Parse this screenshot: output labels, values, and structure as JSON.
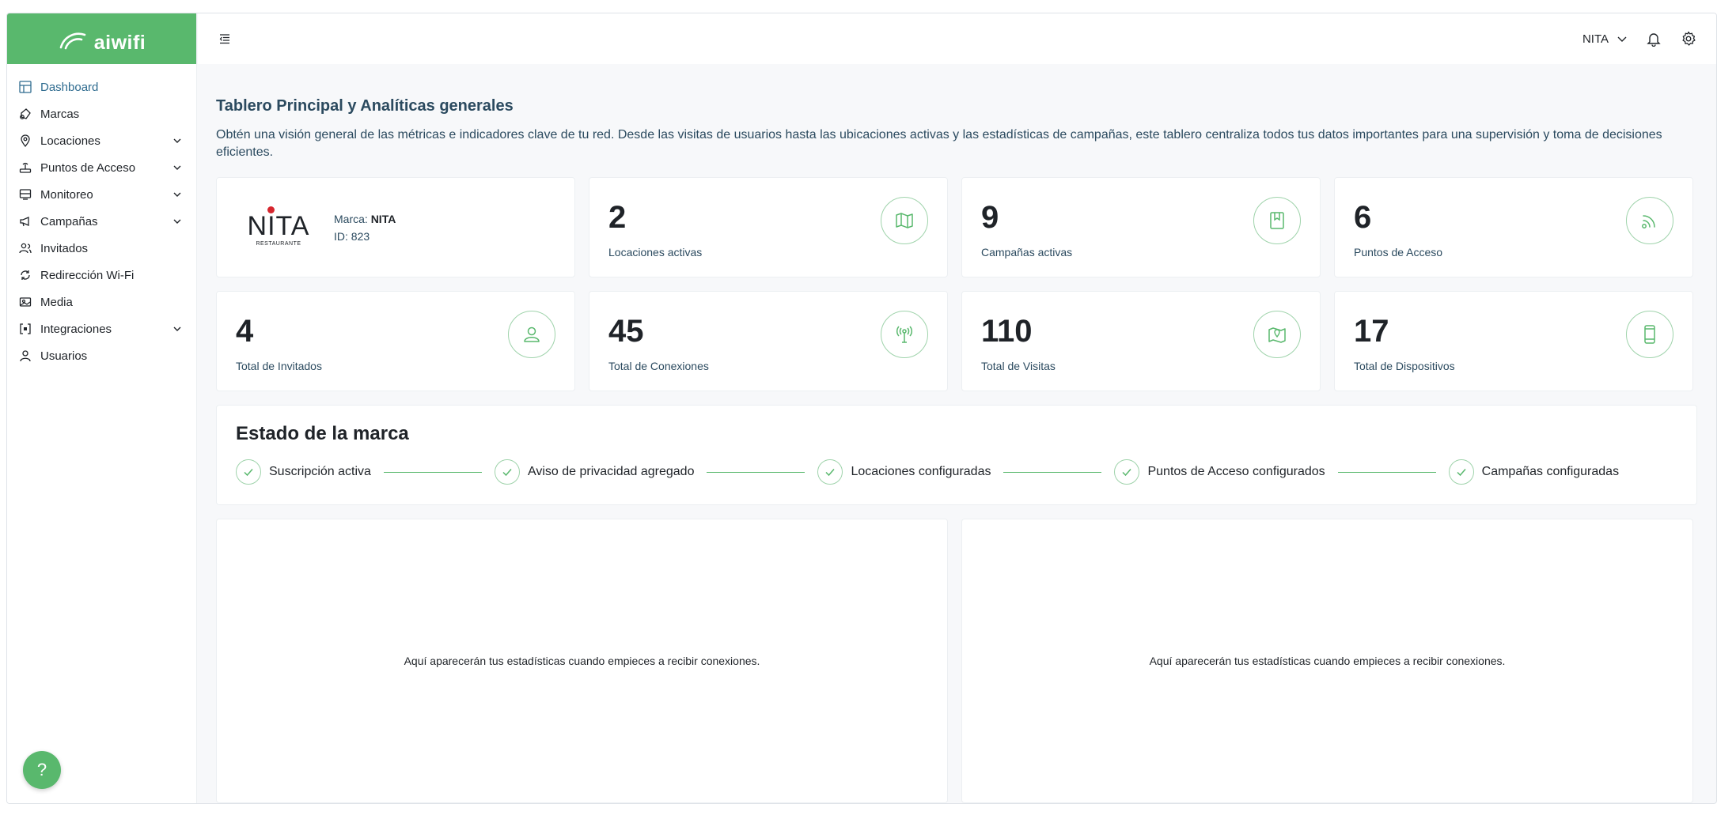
{
  "brand": {
    "logo_text": "aiwifi",
    "accent_color": "#59b86d"
  },
  "sidebar": {
    "items": [
      {
        "label": "Dashboard",
        "icon": "dashboard-icon",
        "active": true,
        "expandable": false
      },
      {
        "label": "Marcas",
        "icon": "brands-icon",
        "active": false,
        "expandable": false
      },
      {
        "label": "Locaciones",
        "icon": "location-pin-icon",
        "active": false,
        "expandable": true
      },
      {
        "label": "Puntos de Acceso",
        "icon": "router-icon",
        "active": false,
        "expandable": true
      },
      {
        "label": "Monitoreo",
        "icon": "monitor-icon",
        "active": false,
        "expandable": true
      },
      {
        "label": "Campañas",
        "icon": "megaphone-icon",
        "active": false,
        "expandable": true
      },
      {
        "label": "Invitados",
        "icon": "users-icon",
        "active": false,
        "expandable": false
      },
      {
        "label": "Redirección Wi-Fi",
        "icon": "redirect-icon",
        "active": false,
        "expandable": false
      },
      {
        "label": "Media",
        "icon": "media-icon",
        "active": false,
        "expandable": false
      },
      {
        "label": "Integraciones",
        "icon": "integrations-icon",
        "active": false,
        "expandable": true
      },
      {
        "label": "Usuarios",
        "icon": "user-icon",
        "active": false,
        "expandable": false
      }
    ],
    "help_label": "?"
  },
  "topbar": {
    "brand_selector": "NITA"
  },
  "main": {
    "title": "Tablero Principal y Analíticas generales",
    "description": "Obtén una visión general de las métricas e indicadores clave de tu red. Desde las visitas de usuarios hasta las ubicaciones activas y las estadísticas de campañas, este tablero centraliza todos tus datos importantes para una supervisión y toma de decisiones eficientes.",
    "brand_card": {
      "logo_name": "NITA",
      "logo_sub": "RESTAURANTE",
      "brand_label": "Marca:",
      "brand_value": "NITA",
      "id_label": "ID:",
      "id_value": "823"
    },
    "stats": [
      {
        "value": "2",
        "label": "Locaciones activas",
        "icon": "map-icon"
      },
      {
        "value": "9",
        "label": "Campañas activas",
        "icon": "bookmark-book-icon"
      },
      {
        "value": "6",
        "label": "Puntos de Acceso",
        "icon": "wifi-signal-icon"
      },
      {
        "value": "4",
        "label": "Total de Invitados",
        "icon": "user-icon"
      },
      {
        "value": "45",
        "label": "Total de Conexiones",
        "icon": "antenna-icon"
      },
      {
        "value": "110",
        "label": "Total de Visitas",
        "icon": "map-pin-icon"
      },
      {
        "value": "17",
        "label": "Total de Dispositivos",
        "icon": "phone-icon"
      }
    ],
    "status": {
      "title": "Estado de la marca",
      "steps": [
        "Suscripción activa",
        "Aviso de privacidad agregado",
        "Locaciones configuradas",
        "Puntos de Acceso configurados",
        "Campañas configuradas"
      ]
    },
    "charts": [
      {
        "empty_message": "Aquí aparecerán tus estadísticas cuando empieces a recibir conexiones."
      },
      {
        "empty_message": "Aquí aparecerán tus estadísticas cuando empieces a recibir conexiones."
      }
    ]
  }
}
